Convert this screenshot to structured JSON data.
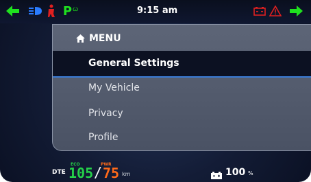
{
  "status": {
    "time": "9:15 am",
    "park_gear": "P",
    "icons": [
      "turn-left-arrow-icon",
      "headlight-icon",
      "seatbelt-icon",
      "park-indicator-icon",
      "time",
      "battery-warning-icon",
      "hazard-warning-icon",
      "turn-right-arrow-icon"
    ]
  },
  "menu": {
    "title": "MENU",
    "items": [
      {
        "label": "General Settings",
        "selected": true
      },
      {
        "label": "My Vehicle",
        "selected": false
      },
      {
        "label": "Privacy",
        "selected": false
      },
      {
        "label": "Profile",
        "selected": false
      }
    ]
  },
  "footer": {
    "dte_label": "DTE",
    "eco_tag": "ECO",
    "eco_value": "105",
    "separator": "/",
    "pwr_tag": "PWR",
    "pwr_value": "75",
    "unit": "km",
    "battery_value": "100",
    "battery_unit": "%"
  },
  "colors": {
    "indicator_green": "#1fe11f",
    "headlight_blue": "#2a7cff",
    "alert_red": "#e02020",
    "eco_green": "#25d14a",
    "pwr_orange": "#ff6a1a",
    "selection_line": "#3a7bd5"
  }
}
